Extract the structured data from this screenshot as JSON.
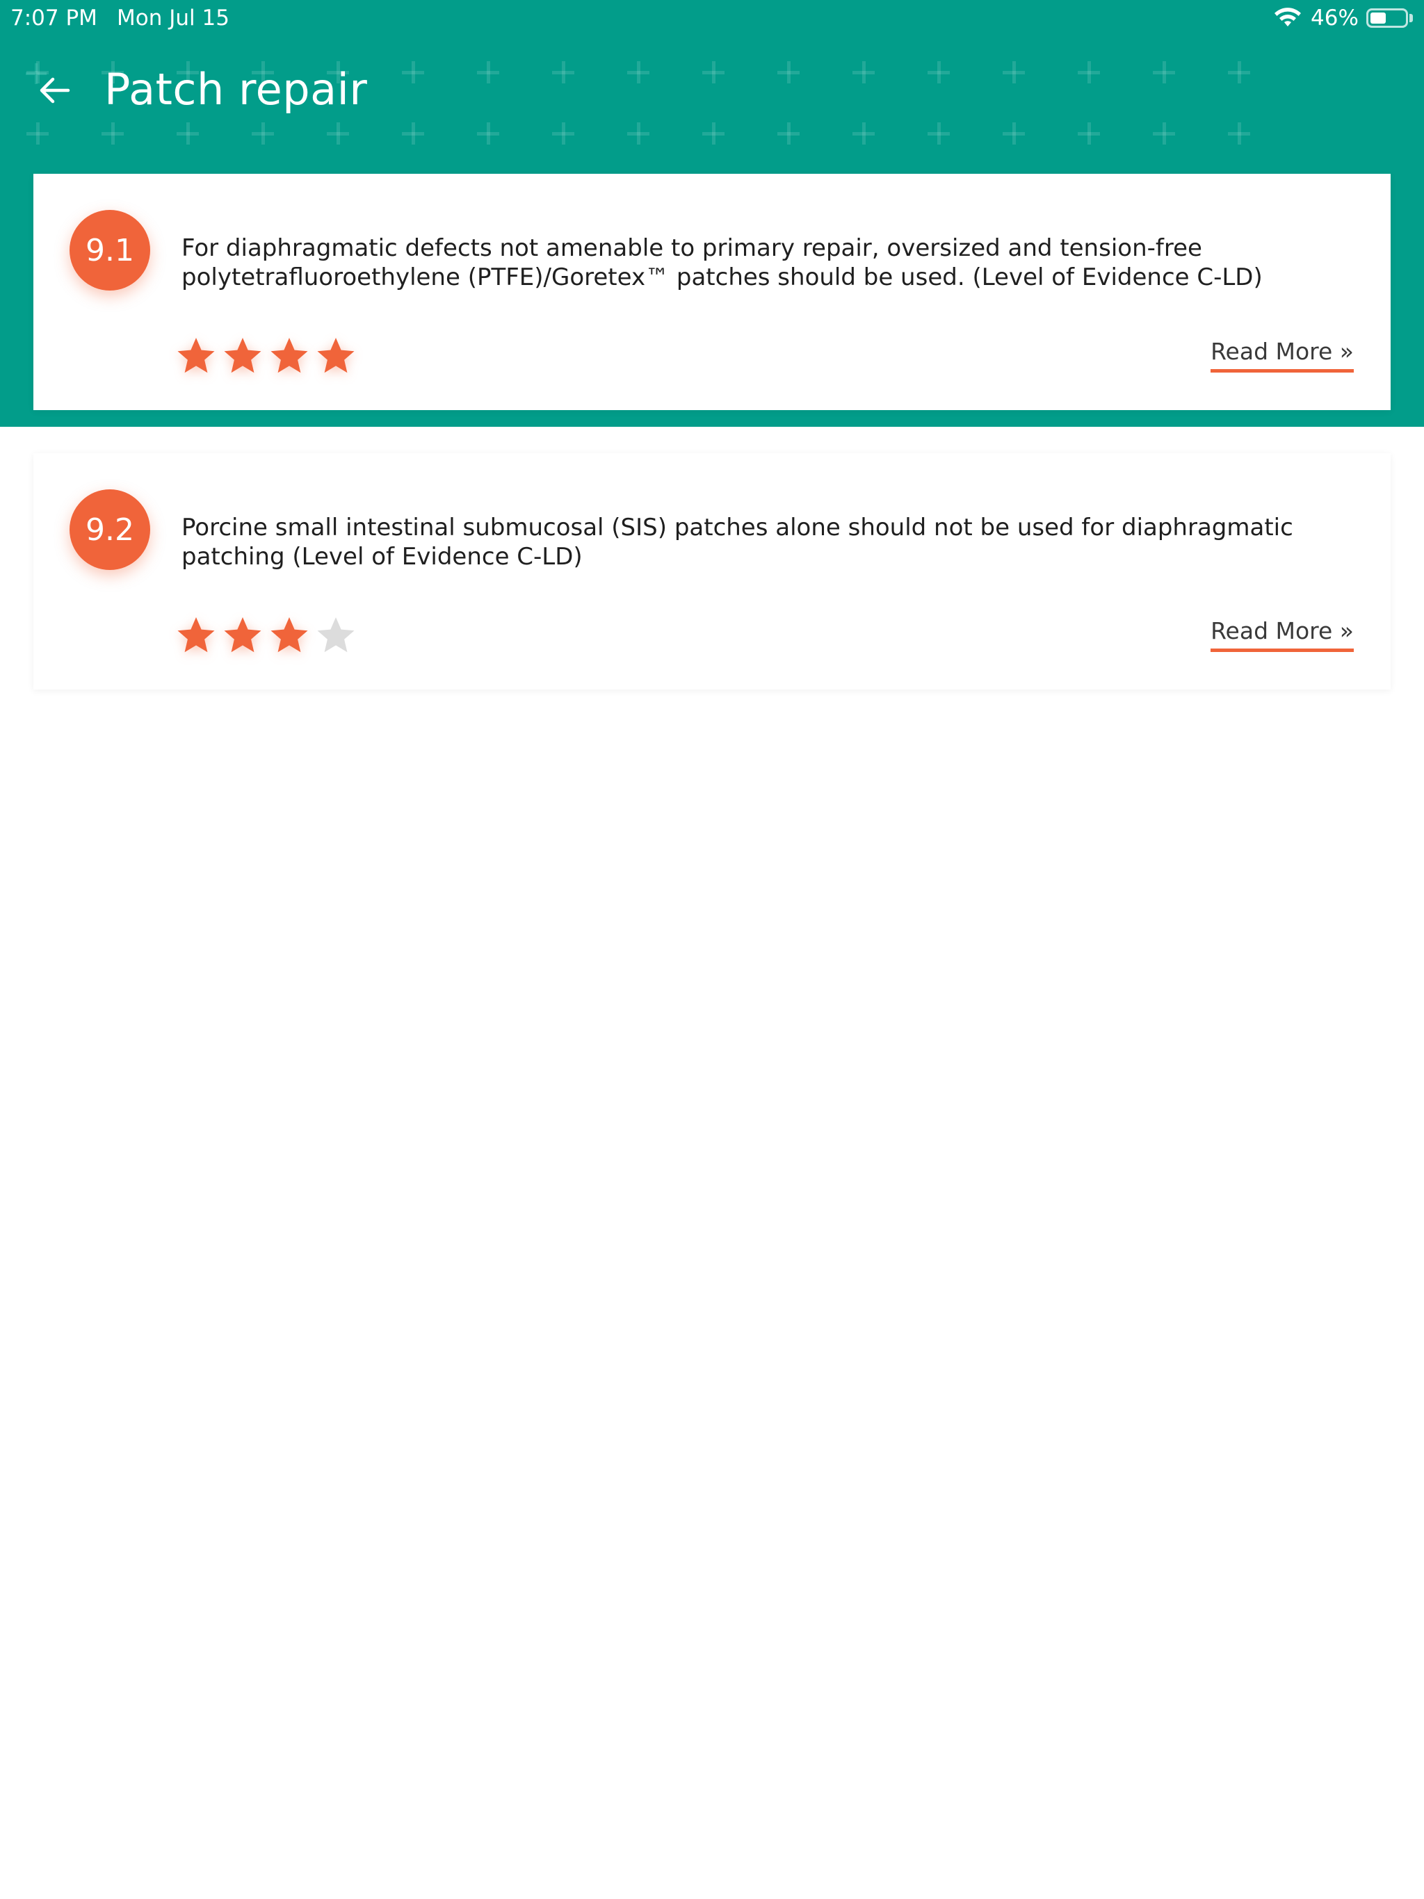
{
  "status_bar": {
    "time": "7:07 PM",
    "date": "Mon Jul 15",
    "battery_percent": "46%",
    "battery_level": 0.46,
    "icons": [
      "wifi-icon",
      "battery-icon"
    ]
  },
  "header": {
    "title": "Patch repair",
    "back_icon": "arrow-left-icon"
  },
  "colors": {
    "header_teal": "#029d8a",
    "accent_orange": "#f0643a",
    "star_inactive": "#dcdcdc",
    "text_dark": "#1f1f1f"
  },
  "recommendations": [
    {
      "number": "9.1",
      "text": "For diaphragmatic defects not amenable to primary repair, oversized and tension-free polytetrafluoroethylene (PTFE)/Goretex™ patches should be used. (Level of Evidence C-LD)",
      "rating": 4,
      "rating_max": 4,
      "link_label": "Read More »"
    },
    {
      "number": "9.2",
      "text": "Porcine small intestinal submucosal (SIS) patches alone should not be used for diaphragmatic patching (Level of Evidence C-LD)",
      "rating": 3,
      "rating_max": 4,
      "link_label": "Read More »"
    }
  ]
}
